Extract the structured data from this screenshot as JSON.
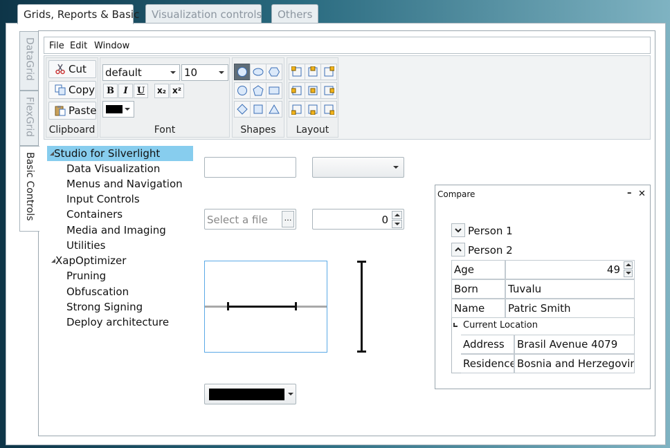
{
  "top_tabs": [
    "Grids, Reports & Basic",
    "Visualization controls",
    "Others"
  ],
  "side_tabs": [
    "DataGrid",
    "FlexGrid",
    "Basic Controls"
  ],
  "menu": [
    "File",
    "Edit",
    "Window"
  ],
  "ribbon": {
    "clipboard": {
      "label": "Clipboard",
      "cut": "Cut",
      "copy": "Copy",
      "paste": "Paste"
    },
    "font": {
      "label": "Font",
      "family": "default",
      "size": "10",
      "bold": "B",
      "italic": "I",
      "underline": "U",
      "subscript": "x₂",
      "superscript": "x²",
      "color": "#000000"
    },
    "shapes": {
      "label": "Shapes"
    },
    "layout": {
      "label": "Layout"
    }
  },
  "tree": {
    "groups": [
      {
        "label": "Studio for Silverlight",
        "items": [
          "Data Visualization",
          "Menus and Navigation",
          "Input Controls",
          "Containers",
          "Media and Imaging",
          "Utilities"
        ]
      },
      {
        "label": "XapOptimizer",
        "items": [
          "Pruning",
          "Obfuscation",
          "Strong Signing",
          "Deploy architecture"
        ]
      }
    ]
  },
  "controls": {
    "file_picker_placeholder": "Select a file",
    "browse_glyph": "…",
    "numeric_value": "0",
    "color_value": "#000000"
  },
  "compare": {
    "title": "Compare",
    "minimize_glyph": "–",
    "close_glyph": "✕",
    "person1": "Person 1",
    "person2": "Person 2",
    "fields": {
      "age_label": "Age",
      "age_value": "49",
      "born_label": "Born",
      "born_value": "Tuvalu",
      "name_label": "Name",
      "name_value": "Patric Smith",
      "location_header": "Current Location",
      "address_label": "Address",
      "address_value": "Brasil Avenue 4079",
      "residence_label": "Residence",
      "residence_value": "Bosnia and Herzegovina"
    }
  }
}
